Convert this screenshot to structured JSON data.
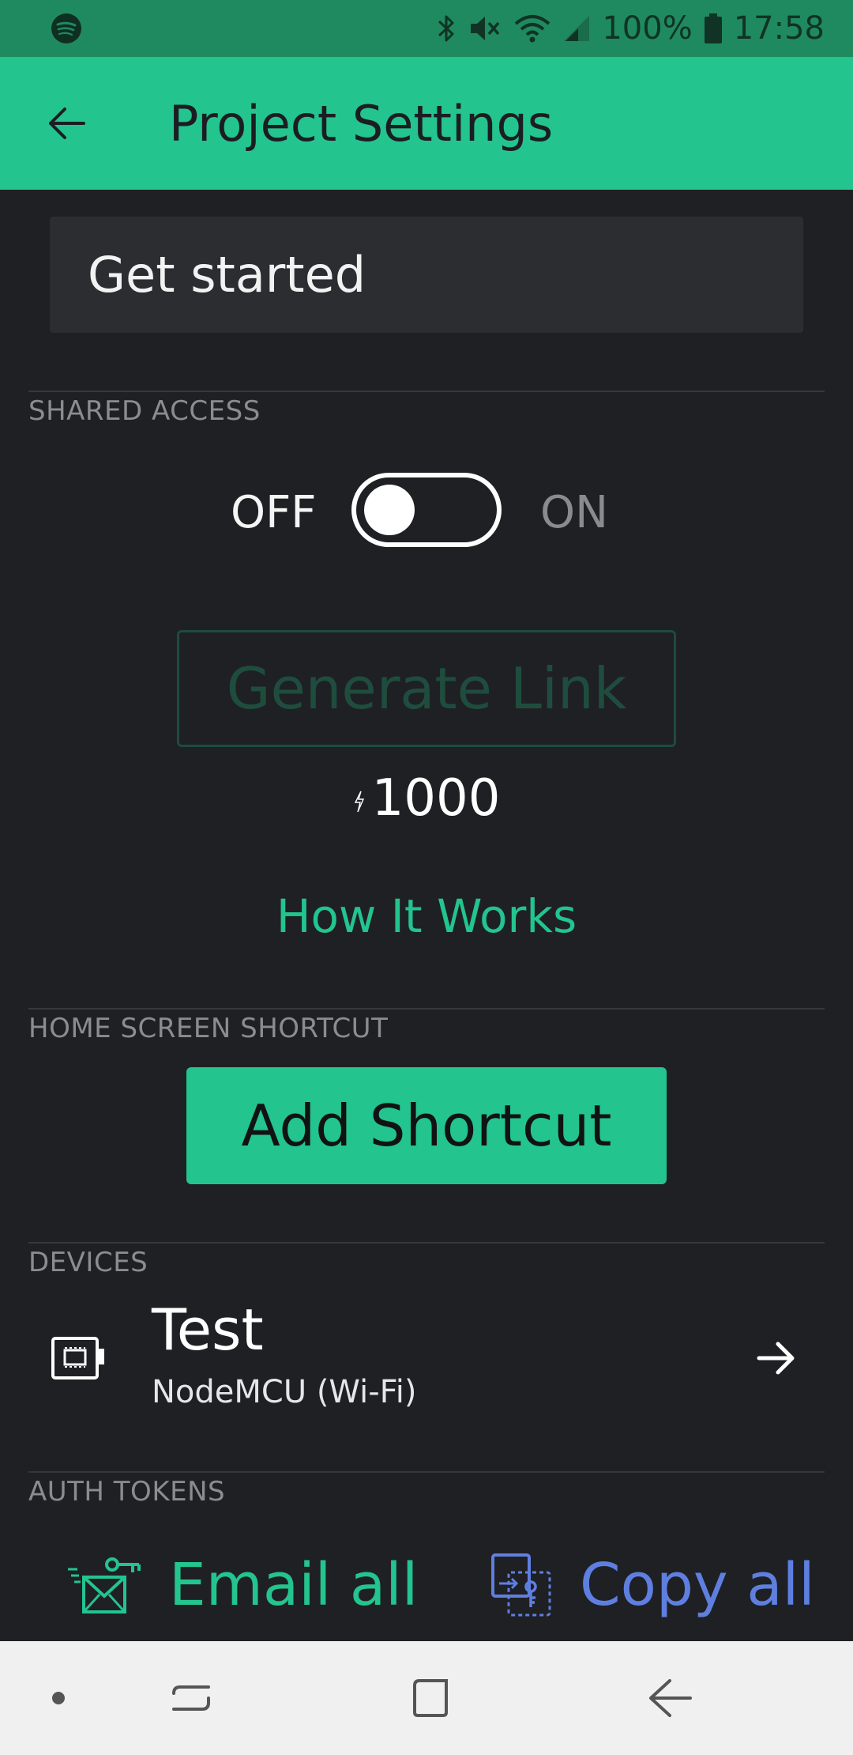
{
  "status_bar": {
    "battery_text": "100%",
    "time": "17:58",
    "icons": [
      "spotify-icon",
      "bluetooth-icon",
      "mute-icon",
      "wifi-icon",
      "signal-icon",
      "battery-icon"
    ]
  },
  "app_bar": {
    "title": "Project Settings",
    "back_icon": "arrow-left-icon"
  },
  "project_name": {
    "value": "Get started"
  },
  "shared_access": {
    "section_label": "SHARED ACCESS",
    "off_label": "OFF",
    "on_label": "ON",
    "toggle_state": "off",
    "generate_button": "Generate Link",
    "energy_cost": "1000",
    "how_it_works": "How It Works"
  },
  "home_screen_shortcut": {
    "section_label": "HOME SCREEN SHORTCUT",
    "button": "Add Shortcut"
  },
  "devices": {
    "section_label": "DEVICES",
    "items": [
      {
        "name": "Test",
        "type": "NodeMCU (Wi-Fi)"
      }
    ]
  },
  "auth_tokens": {
    "section_label": "AUTH TOKENS",
    "email_all": "Email all",
    "copy_all": "Copy all"
  },
  "colors": {
    "accent": "#23c48e",
    "background": "#1f2024",
    "copy_blue": "#5f7fe0"
  }
}
